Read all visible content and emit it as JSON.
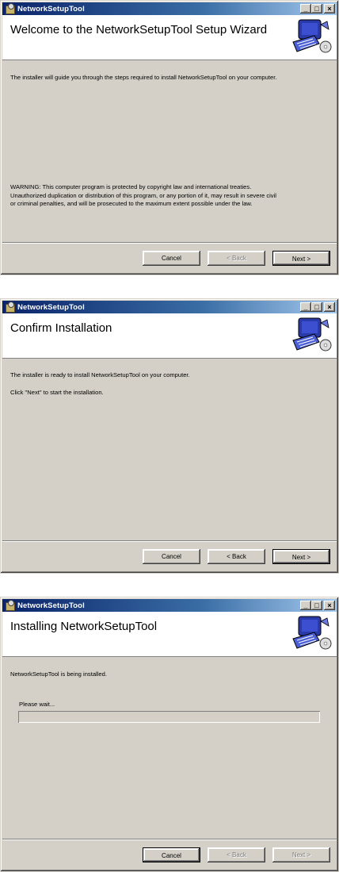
{
  "app": {
    "title": "NetworkSetupTool"
  },
  "titlebar_buttons": {
    "minimize": "_",
    "maximize": "□",
    "close": "×"
  },
  "screens": [
    {
      "header": "Welcome to the NetworkSetupTool Setup Wizard",
      "intro": "The installer will guide you through the steps required to install NetworkSetupTool on your computer.",
      "warning_line1": "WARNING: This computer program is protected by copyright law and international treaties.",
      "warning_line2": "Unauthorized duplication or distribution of this program, or any portion of it, may result in severe civil",
      "warning_line3": "or criminal penalties, and will be prosecuted to the maximum extent possible under the law.",
      "buttons": {
        "cancel": "Cancel",
        "back": "< Back",
        "next": "Next >"
      }
    },
    {
      "header": "Confirm Installation",
      "line1": "The installer is ready to install NetworkSetupTool on your computer.",
      "line2": "Click \"Next\" to start the installation.",
      "buttons": {
        "cancel": "Cancel",
        "back": "< Back",
        "next": "Next >"
      }
    },
    {
      "header": "Installing NetworkSetupTool",
      "line1": "NetworkSetupTool is being installed.",
      "wait_label": "Please wait...",
      "progress": 0,
      "buttons": {
        "cancel": "Cancel",
        "back": "< Back",
        "next": "Next >"
      }
    }
  ],
  "icons": {
    "app": "installer-box-icon",
    "header_art": "computer-setup-icon"
  },
  "colors": {
    "titlebar_start": "#0a246a",
    "titlebar_end": "#a6caf0",
    "dialog_bg": "#d4d0c8"
  }
}
